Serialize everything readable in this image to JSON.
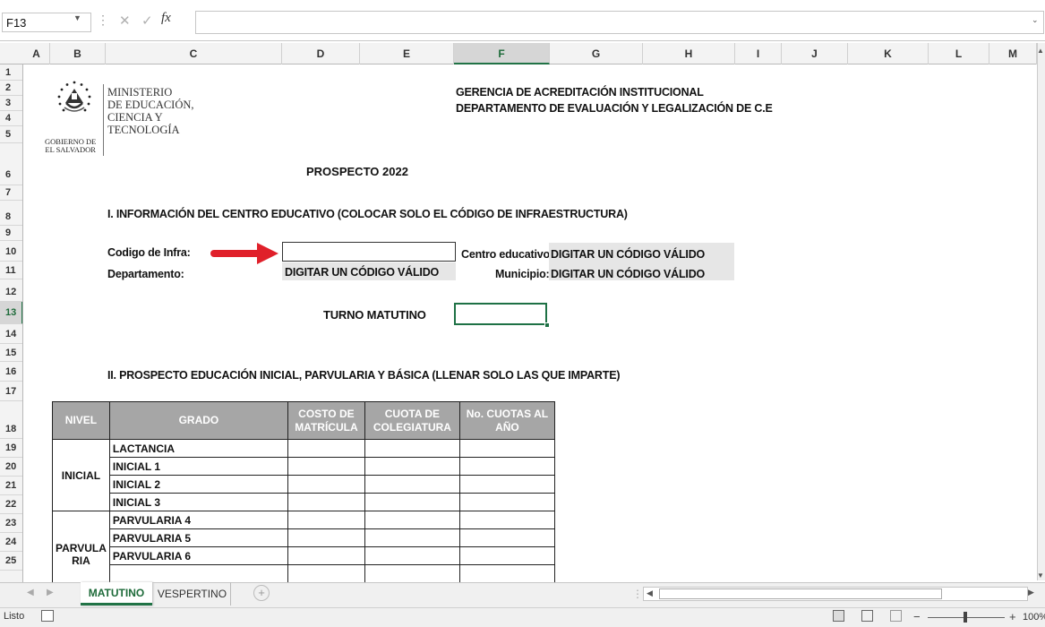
{
  "formula_bar": {
    "name_box": "F13",
    "fx_label": "fx",
    "formula": ""
  },
  "columns": [
    "A",
    "B",
    "C",
    "D",
    "E",
    "F",
    "G",
    "H",
    "I",
    "J",
    "K",
    "L",
    "M"
  ],
  "selected_column": "F",
  "rows": [
    "1",
    "2",
    "3",
    "4",
    "5",
    "6",
    "7",
    "8",
    "9",
    "10",
    "11",
    "12",
    "13",
    "14",
    "15",
    "16",
    "17",
    "18",
    "19",
    "20",
    "21",
    "22",
    "23",
    "24",
    "25"
  ],
  "selected_row": "13",
  "header": {
    "ministry_lines": [
      "MINISTERIO",
      "DE EDUCACIÓN,",
      "CIENCIA Y",
      "TECNOLOGÍA"
    ],
    "gov_lines": [
      "GOBIERNO DE",
      "EL SALVADOR"
    ],
    "gerencia": "GERENCIA DE ACREDITACIÓN INSTITUCIONAL",
    "departamento": "DEPARTAMENTO DE EVALUACIÓN Y LEGALIZACIÓN DE C.E",
    "prospecto": "PROSPECTO 2022"
  },
  "section1": {
    "title": "I. INFORMACIÓN DEL CENTRO EDUCATIVO (COLOCAR SOLO EL CÓDIGO DE INFRAESTRUCTURA)",
    "codigo_label": "Codigo de Infra:",
    "codigo_value": "",
    "departamento_label": "Departamento:",
    "departamento_value": "DIGITAR UN CÓDIGO VÁLIDO",
    "centro_label": "Centro educativo:",
    "centro_value": "DIGITAR UN CÓDIGO VÁLIDO",
    "municipio_label": "Municipio:",
    "municipio_value": "DIGITAR UN CÓDIGO VÁLIDO",
    "turno_label": "TURNO MATUTINO",
    "turno_value": ""
  },
  "section2": {
    "title": "II. PROSPECTO EDUCACIÓN INICIAL, PARVULARIA Y BÁSICA (LLENAR SOLO LAS QUE IMPARTE)"
  },
  "table": {
    "headers": {
      "nivel": "NIVEL",
      "grado": "GRADO",
      "costo": [
        "COSTO DE",
        "MATRÍCULA"
      ],
      "cuota": [
        "CUOTA DE",
        "COLEGIATURA"
      ],
      "no_cuotas": [
        "No. CUOTAS AL",
        "AÑO"
      ]
    },
    "groups": [
      {
        "nivel": "INICIAL",
        "grados": [
          "LACTANCIA",
          "INICIAL 1",
          "INICIAL 2",
          "INICIAL 3"
        ]
      },
      {
        "nivel_lines": [
          "PARVULA",
          "RIA"
        ],
        "grados": [
          "PARVULARIA 4",
          "PARVULARIA 5",
          "PARVULARIA 6"
        ]
      }
    ]
  },
  "sheet_tabs": [
    "MATUTINO",
    "VESPERTINO"
  ],
  "active_tab": "MATUTINO",
  "status": {
    "text": "Listo",
    "zoom": "100%"
  },
  "colors": {
    "excel_green": "#217346",
    "table_header": "#a6a6a6",
    "gray_fill": "#e6e6e6",
    "arrow_red": "#e0202a"
  }
}
